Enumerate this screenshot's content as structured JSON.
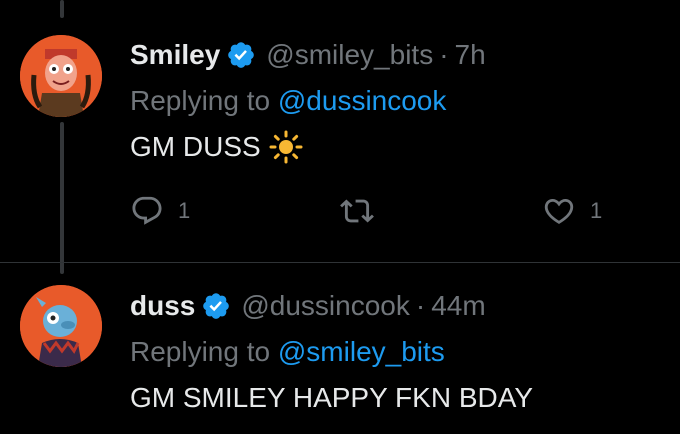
{
  "tweets": [
    {
      "display_name": "Smiley",
      "handle": "@smiley_bits",
      "separator": "·",
      "time": "7h",
      "replying_prefix": "Replying to",
      "replying_to": "@dussincook",
      "text": "GM DUSS",
      "emoji": "sun-icon",
      "reply_count": "1",
      "retweet_count": "",
      "like_count": "1",
      "avatar_color": "#e85a2a"
    },
    {
      "display_name": "duss",
      "handle": "@dussincook",
      "separator": "·",
      "time": "44m",
      "replying_prefix": "Replying to",
      "replying_to": "@smiley_bits",
      "text": "GM SMILEY HAPPY FKN BDAY",
      "avatar_color": "#e85a2a"
    }
  ],
  "colors": {
    "background": "#000000",
    "text": "#e7e9ea",
    "muted": "#71767b",
    "link": "#1d9bf0",
    "verified": "#1d9bf0",
    "thread_line": "#333639"
  }
}
